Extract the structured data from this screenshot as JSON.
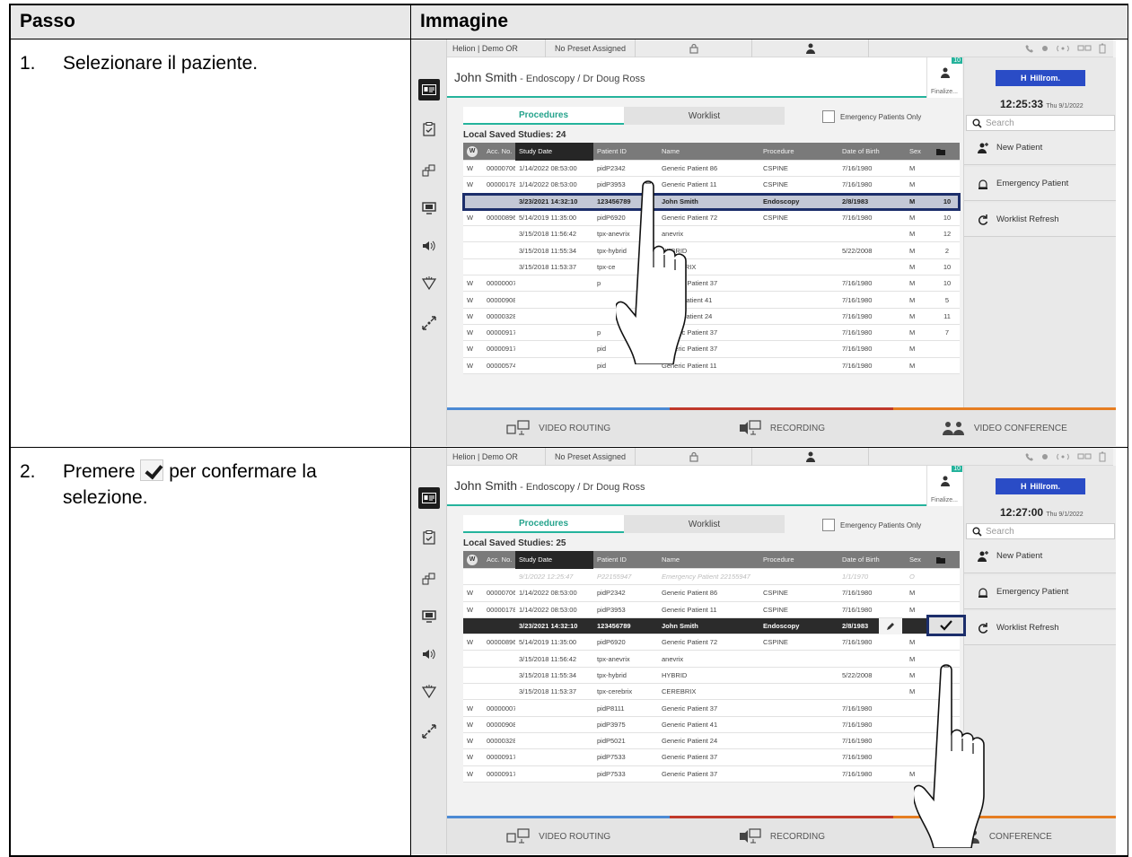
{
  "header": {
    "col_step": "Passo",
    "col_image": "Immagine"
  },
  "steps": [
    {
      "num": "1.",
      "text_before": "Selezionare il paziente.",
      "text_after": "",
      "ui": {
        "topbar": {
          "location": "Helion | Demo OR",
          "preset": "No Preset Assigned"
        },
        "patient_name": "John Smith",
        "patient_sub": " - Endoscopy / Dr Doug Ross",
        "finalize_label": "Finalize...",
        "finalize_badge": "10",
        "brand": "Hillrom.",
        "clock_time": "12:25:33",
        "clock_date": "Thu 9/1/2022",
        "search_placeholder": "Search",
        "right_buttons": [
          "New Patient",
          "Emergency Patient",
          "Worklist Refresh"
        ],
        "tabs": [
          "Procedures",
          "Worklist"
        ],
        "emergency_only": "Emergency Patients Only",
        "saved_label": "Local Saved Studies: 24",
        "columns": [
          "W",
          "Acc. No.",
          "Study Date",
          "Patient ID",
          "Name",
          "Procedure",
          "Date of Birth",
          "Sex",
          ""
        ],
        "rows": [
          [
            "W",
            "00000706",
            "1/14/2022 08:53:00",
            "pidP2342",
            "Generic Patient 86",
            "CSPINE",
            "7/16/1980",
            "M",
            ""
          ],
          [
            "W",
            "00000178",
            "1/14/2022 08:53:00",
            "pidP3953",
            "Generic Patient 11",
            "CSPINE",
            "7/16/1980",
            "M",
            ""
          ],
          [
            "",
            "",
            "3/23/2021 14:32:10",
            "123456789",
            "John Smith",
            "Endoscopy",
            "2/8/1983",
            "M",
            "10"
          ],
          [
            "W",
            "00000896",
            "5/14/2019 11:35:00",
            "pidP6920",
            "Generic Patient 72",
            "CSPINE",
            "7/16/1980",
            "M",
            "10"
          ],
          [
            "",
            "",
            "3/15/2018 11:56:42",
            "tpx-anevrix",
            "anevrix",
            "",
            "",
            "M",
            "12"
          ],
          [
            "",
            "",
            "3/15/2018 11:55:34",
            "tpx-hybrid",
            "HYBRID",
            "",
            "5/22/2008",
            "M",
            "2"
          ],
          [
            "",
            "",
            "3/15/2018 11:53:37",
            "tpx-ce",
            "CEREBRIX",
            "",
            "",
            "M",
            "10"
          ],
          [
            "W",
            "00000007",
            "",
            "p",
            "Generic Patient 37",
            "",
            "7/16/1980",
            "M",
            "10"
          ],
          [
            "W",
            "00000908",
            "",
            "",
            "eneric Patient 41",
            "",
            "7/16/1980",
            "M",
            "5"
          ],
          [
            "W",
            "00000328",
            "",
            "",
            "eneric Patient 24",
            "",
            "7/16/1980",
            "M",
            "11"
          ],
          [
            "W",
            "00000917",
            "",
            "p",
            "Generic Patient 37",
            "",
            "7/16/1980",
            "M",
            "7"
          ],
          [
            "W",
            "00000917",
            "",
            "pid",
            "Generic Patient 37",
            "",
            "7/16/1980",
            "M",
            ""
          ],
          [
            "W",
            "00000574",
            "",
            "pid",
            "Generic Patient 11",
            "",
            "7/16/1980",
            "M",
            ""
          ]
        ],
        "selected_row": 2,
        "bottom": [
          "VIDEO ROUTING",
          "RECORDING",
          "VIDEO CONFERENCE"
        ]
      }
    },
    {
      "num": "2.",
      "text_before": "Premere ",
      "text_after": " per confermare la selezione.",
      "ui": {
        "topbar": {
          "location": "Helion | Demo OR",
          "preset": "No Preset Assigned"
        },
        "patient_name": "John Smith",
        "patient_sub": " - Endoscopy / Dr Doug Ross",
        "finalize_label": "Finalize...",
        "finalize_badge": "10",
        "brand": "Hillrom.",
        "clock_time": "12:27:00",
        "clock_date": "Thu 9/1/2022",
        "search_placeholder": "Search",
        "right_buttons": [
          "New Patient",
          "Emergency Patient",
          "Worklist Refresh"
        ],
        "tabs": [
          "Procedures",
          "Worklist"
        ],
        "emergency_only": "Emergency Patients Only",
        "saved_label": "Local Saved Studies: 25",
        "columns": [
          "W",
          "Acc. No.",
          "Study Date",
          "Patient ID",
          "Name",
          "Procedure",
          "Date of Birth",
          "Sex",
          ""
        ],
        "rows": [
          [
            "",
            "",
            "9/1/2022 12:25:47",
            "P22155947",
            "Emergency Patient 22155947",
            "",
            "1/1/1970",
            "O",
            ""
          ],
          [
            "W",
            "00000706",
            "1/14/2022 08:53:00",
            "pidP2342",
            "Generic Patient 86",
            "CSPINE",
            "7/16/1980",
            "M",
            ""
          ],
          [
            "W",
            "00000178",
            "1/14/2022 08:53:00",
            "pidP3953",
            "Generic Patient 11",
            "CSPINE",
            "7/16/1980",
            "M",
            ""
          ],
          [
            "",
            "",
            "3/23/2021 14:32:10",
            "123456789",
            "John Smith",
            "Endoscopy",
            "2/8/1983",
            "",
            ""
          ],
          [
            "W",
            "00000896",
            "5/14/2019 11:35:00",
            "pidP6920",
            "Generic Patient 72",
            "CSPINE",
            "7/16/1980",
            "M",
            ""
          ],
          [
            "",
            "",
            "3/15/2018 11:56:42",
            "tpx-anevrix",
            "anevrix",
            "",
            "",
            "M",
            ""
          ],
          [
            "",
            "",
            "3/15/2018 11:55:34",
            "tpx-hybrid",
            "HYBRID",
            "",
            "5/22/2008",
            "M",
            ""
          ],
          [
            "",
            "",
            "3/15/2018 11:53:37",
            "tpx-cerebrix",
            "CEREBRIX",
            "",
            "",
            "M",
            ""
          ],
          [
            "W",
            "00000007",
            "",
            "pidP8111",
            "Generic Patient 37",
            "",
            "7/16/1980",
            "",
            ""
          ],
          [
            "W",
            "00000908",
            "",
            "pidP3975",
            "Generic Patient 41",
            "",
            "7/16/1980",
            "",
            ""
          ],
          [
            "W",
            "00000328",
            "",
            "pidP5021",
            "Generic Patient 24",
            "",
            "7/16/1980",
            "",
            ""
          ],
          [
            "W",
            "00000917",
            "",
            "pidP7533",
            "Generic Patient 37",
            "",
            "7/16/1980",
            "",
            ""
          ],
          [
            "W",
            "00000917",
            "",
            "pidP7533",
            "Generic Patient 37",
            "",
            "7/16/1980",
            "M",
            ""
          ]
        ],
        "selected_row": 3,
        "emergency_row": 0,
        "bottom": [
          "VIDEO ROUTING",
          "RECORDING",
          "CONFERENCE"
        ]
      }
    }
  ],
  "colors": {
    "accent": "#25b39c",
    "highlight": "#1c2e6b",
    "brand": "#2a4cc6"
  }
}
